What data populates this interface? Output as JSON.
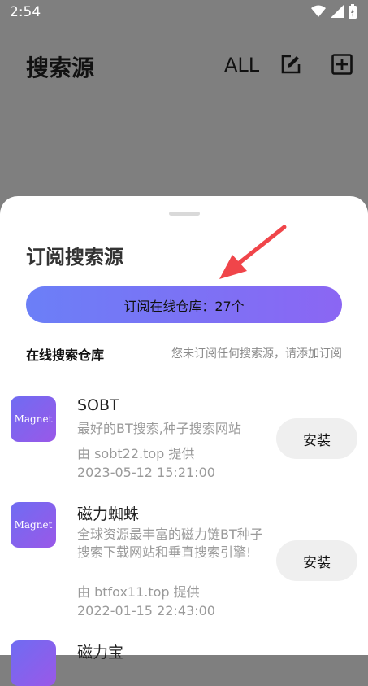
{
  "status_bar": {
    "time": "2:54"
  },
  "appbar": {
    "title": "搜索源",
    "all_label": "ALL"
  },
  "sheet": {
    "title": "订阅搜索源",
    "subscribe_button": "订阅在线仓库：27个",
    "section_title": "在线搜索仓库",
    "section_note": "您未订阅任何搜索源，请添加订阅"
  },
  "items": [
    {
      "icon_text": "Magnet",
      "name": "SOBT",
      "desc": "最好的BT搜索,种子搜索网站",
      "provider": "由 sobt22.top 提供",
      "date": "2023-05-12 15:21:00",
      "install": "安装"
    },
    {
      "icon_text": "Magnet",
      "name": "磁力蜘蛛",
      "desc": "全球资源最丰富的磁力链BT种子搜索下载网站和垂直搜索引擎!",
      "provider": "由 btfox11.top 提供",
      "date": "2022-01-15 22:43:00",
      "install": "安装"
    },
    {
      "name": "磁力宝"
    }
  ],
  "colors": {
    "accent_start": "#6b7ff7",
    "accent_end": "#8b66f3",
    "arrow": "#f0454a"
  }
}
